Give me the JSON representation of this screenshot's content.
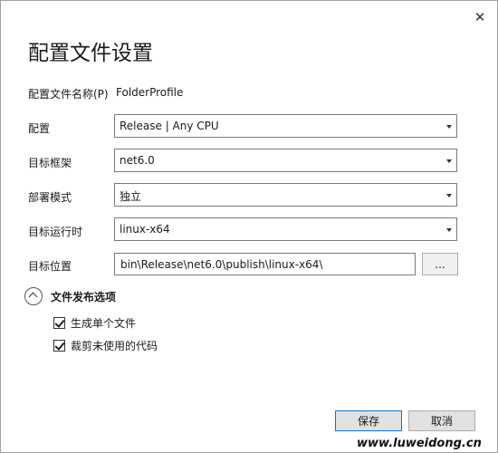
{
  "dialog": {
    "close_glyph": "✕",
    "title": "配置文件设置"
  },
  "form": {
    "profile_name": {
      "label": "配置文件名称(P)",
      "value": "FolderProfile"
    },
    "configuration": {
      "label": "配置",
      "value": "Release | Any CPU"
    },
    "target_framework": {
      "label": "目标框架",
      "value": "net6.0"
    },
    "deployment_mode": {
      "label": "部署模式",
      "value": "独立"
    },
    "target_runtime": {
      "label": "目标运行时",
      "value": "linux-x64"
    },
    "target_location": {
      "label": "目标位置",
      "value": "bin\\Release\\net6.0\\publish\\linux-x64\\",
      "browse_label": "..."
    }
  },
  "publish_options": {
    "title": "文件发布选项",
    "expanded": true,
    "options": [
      {
        "label": "生成单个文件",
        "checked": true
      },
      {
        "label": "裁剪未使用的代码",
        "checked": true
      }
    ]
  },
  "buttons": {
    "save": "保存",
    "cancel": "取消"
  },
  "watermark": "www.luweidong.cn",
  "colors": {
    "accent": "#0078d7",
    "border": "#7a7a7a",
    "button_bg": "#e1e1e1"
  }
}
